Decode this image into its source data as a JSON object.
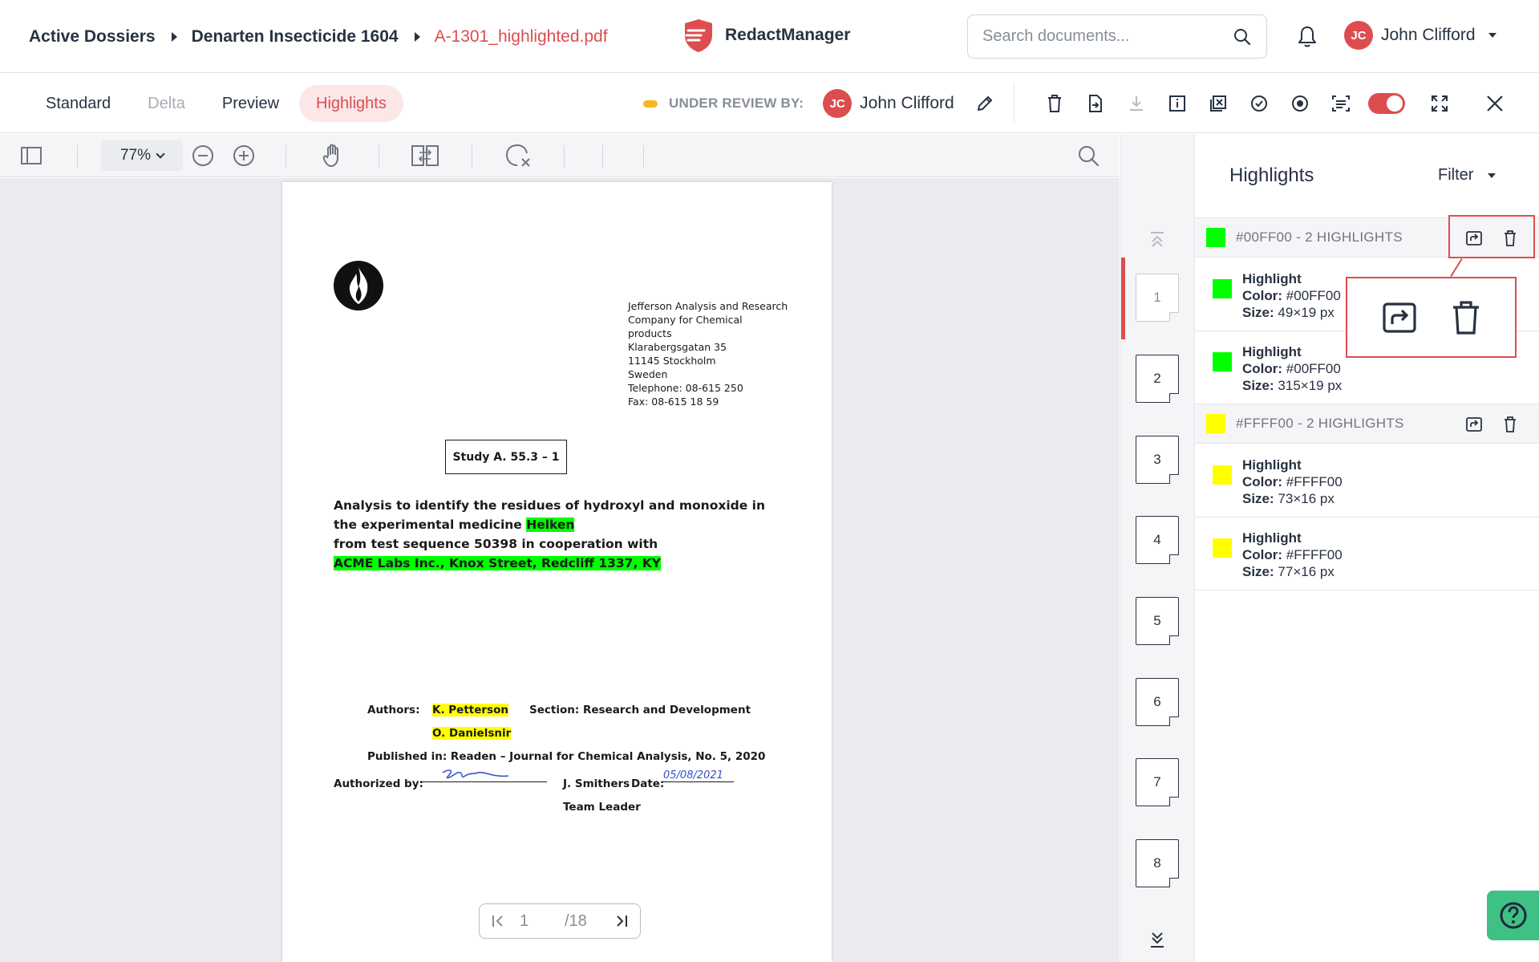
{
  "breadcrumb": {
    "items": [
      "Active Dossiers",
      "Denarten Insecticide 1604",
      "A-1301_highlighted.pdf"
    ]
  },
  "app": {
    "name": "RedactManager",
    "brand_color": "#dd4d50"
  },
  "search": {
    "placeholder": "Search documents..."
  },
  "user": {
    "initials": "JC",
    "name": "John Clifford"
  },
  "view_tabs": [
    "Standard",
    "Delta",
    "Preview",
    "Highlights"
  ],
  "active_tab": "Highlights",
  "review": {
    "label": "UNDER REVIEW BY:",
    "initials": "JC",
    "name": "John Clifford",
    "status_color": "#f5b821"
  },
  "viewer": {
    "zoom": "77%",
    "page_current": "1",
    "page_total": "/18"
  },
  "document": {
    "address": [
      "Jefferson Analysis and Research",
      "Company for Chemical",
      "products",
      "Klarabergsgatan 35",
      "11145 Stockholm",
      "Sweden",
      "Telephone: 08-615 250",
      "Fax: 08-615 18 59"
    ],
    "study": "Study A. 55.3 – 1",
    "title_line1": "Analysis to identify the residues of hydroxyl and monoxide in",
    "title_line2_prefix": "the experimental medicine ",
    "title_line2_highlight": "Helken",
    "title_line3": "from test sequence 50398 in cooperation with",
    "title_line4_highlight": "ACME Labs Inc., Knox Street, Redcliff 1337, KY",
    "authors_label": "Authors:",
    "author1": "K. Petterson",
    "author2": "O. Danielsnir",
    "section": "Section: Research and Development",
    "published": "Published in: Readen – Journal for Chemical Analysis, No. 5, 2020",
    "authorized_label": "Authorized by:",
    "signer": "J. Smithers",
    "date_label": "Date:",
    "date_value": "05/08/2021",
    "role": "Team Leader"
  },
  "thumbnails": [
    "1",
    "2",
    "3",
    "4",
    "5",
    "6",
    "7",
    "8"
  ],
  "panel": {
    "title": "Highlights",
    "filter_label": "Filter",
    "groups": [
      {
        "label": "#00FF00 - 2 HIGHLIGHTS",
        "color": "#00ff00",
        "items": [
          {
            "title": "Highlight",
            "color_label": "Color:",
            "color_value": "#00FF00",
            "size_label": "Size:",
            "size_value": "49×19 px"
          },
          {
            "title": "Highlight",
            "color_label": "Color:",
            "color_value": "#00FF00",
            "size_label": "Size:",
            "size_value": "315×19 px"
          }
        ]
      },
      {
        "label": "#FFFF00 - 2 HIGHLIGHTS",
        "color": "#ffff00",
        "items": [
          {
            "title": "Highlight",
            "color_label": "Color:",
            "color_value": "#FFFF00",
            "size_label": "Size:",
            "size_value": "73×16 px"
          },
          {
            "title": "Highlight",
            "color_label": "Color:",
            "color_value": "#FFFF00",
            "size_label": "Size:",
            "size_value": "77×16 px"
          }
        ]
      }
    ]
  },
  "icons": {
    "toolbar": [
      "trash-icon",
      "export-icon",
      "download-icon",
      "info-icon",
      "exclude-icon",
      "check-circle-icon",
      "record-icon",
      "ocr-icon",
      "toggle",
      "fullscreen-icon",
      "close-icon"
    ],
    "help": "help-icon"
  }
}
